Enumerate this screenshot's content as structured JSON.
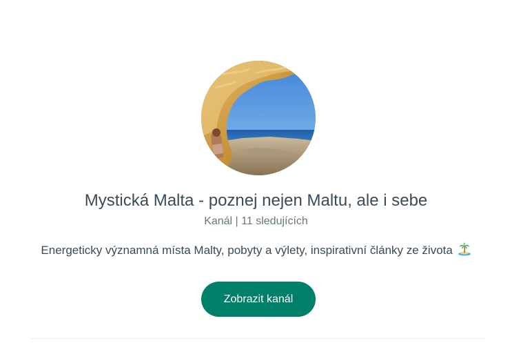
{
  "channel": {
    "name": "Mystická Malta - poznej nejen Maltu, ale i sebe",
    "meta": "Kanál | 11 sledujících",
    "description": "Energeticky významná místa Malty, pobyty a výlety, inspirativní články ze života",
    "description_emoji": "desert-island-icon",
    "avatar": "channel-avatar-photo",
    "view_button_label": "Zobrazit kanál"
  },
  "colors": {
    "accent": "#008069",
    "title_text": "#3b4a54",
    "secondary_text": "#667781",
    "divider": "#e9edef"
  }
}
